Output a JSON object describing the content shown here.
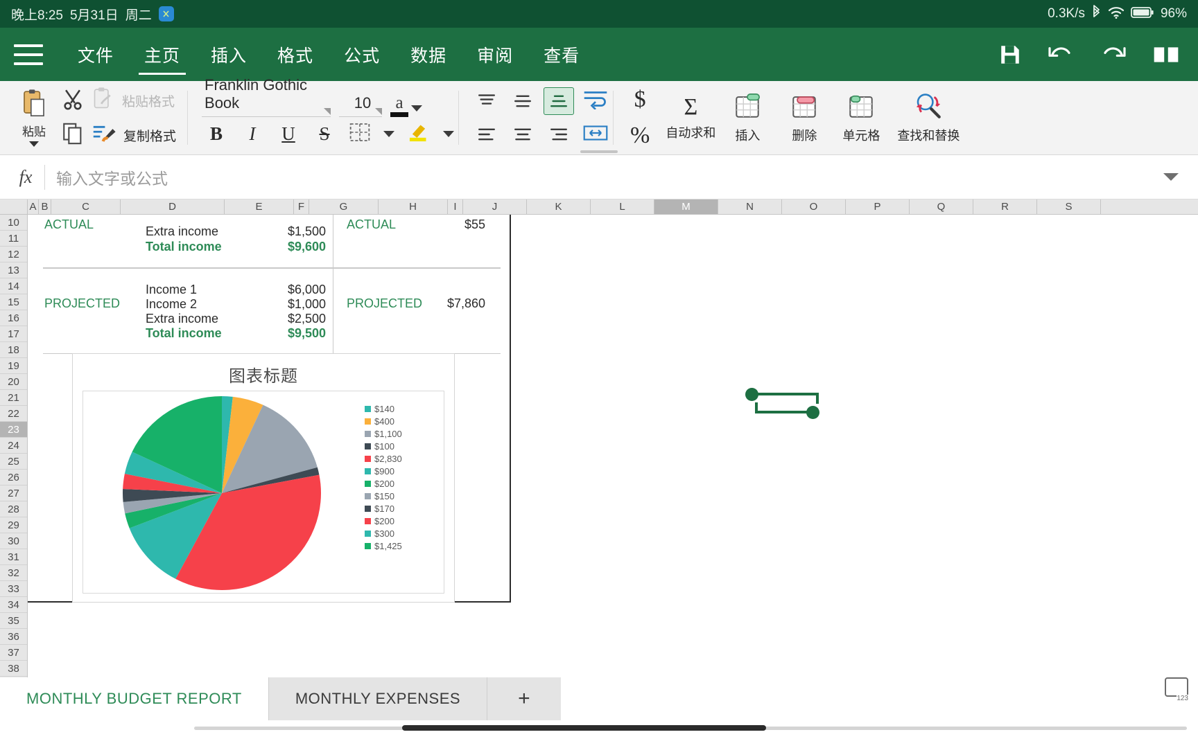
{
  "statusbar": {
    "time": "晚上8:25",
    "date": "5月31日",
    "weekday": "周二",
    "app_badge": "XL",
    "network_speed": "0.3K/s",
    "bluetooth_icon": "bluetooth-icon",
    "wifi_icon": "wifi-icon",
    "battery_icon": "battery-icon",
    "battery_text": "96%"
  },
  "ribbon": {
    "menu_icon": "hamburger-menu-icon",
    "tabs": [
      {
        "label": "文件",
        "active": false
      },
      {
        "label": "主页",
        "active": true
      },
      {
        "label": "插入",
        "active": false
      },
      {
        "label": "格式",
        "active": false
      },
      {
        "label": "公式",
        "active": false
      },
      {
        "label": "数据",
        "active": false
      },
      {
        "label": "审阅",
        "active": false
      },
      {
        "label": "查看",
        "active": false
      }
    ],
    "right_icons": [
      "save-icon",
      "undo-icon",
      "redo-icon",
      "read-mode-icon"
    ]
  },
  "toolbar": {
    "paste_label": "粘贴",
    "paste_icon": "paste-icon",
    "cut_icon": "cut-icon",
    "copy_icon": "copy-icon",
    "paste_format_label": "粘贴格式",
    "paste_format_icon": "paste-format-icon",
    "copy_format_label": "复制格式",
    "copy_format_icon": "format-painter-icon",
    "font_name": "Franklin Gothic Book",
    "font_size": "10",
    "font_color_glyph": "a",
    "font_color": "#111111",
    "bold": "B",
    "italic": "I",
    "underline": "U",
    "strikethrough": "S",
    "borders_icon": "borders-icon",
    "highlight_icon": "highlight-icon",
    "align_top_icon": "align-top-icon",
    "align_middle_icon": "align-middle-icon",
    "align_bottom_icon": "align-bottom-icon",
    "align_left_icon": "align-left-icon",
    "align_center_icon": "align-center-icon",
    "align_right_icon": "align-right-icon",
    "wrap_text_icon": "wrap-text-icon",
    "merge_cells_icon": "merge-cells-icon",
    "currency_icon": "$",
    "percent_icon": "%",
    "autosum_icon": "Σ",
    "autosum_label": "自动求和",
    "insert_label": "插入",
    "insert_icon": "insert-cells-icon",
    "delete_label": "删除",
    "delete_icon": "delete-cells-icon",
    "cell_label": "单元格",
    "cell_icon": "cell-format-icon",
    "find_replace_label": "查找和替换",
    "find_replace_icon": "find-replace-icon"
  },
  "formula_bar": {
    "fx_label": "fx",
    "placeholder": "输入文字或公式",
    "value": "",
    "expand_icon": "chevron-down-icon"
  },
  "grid": {
    "columns": [
      "A",
      "B",
      "C",
      "D",
      "E",
      "F",
      "G",
      "H",
      "I",
      "J",
      "K",
      "L",
      "M",
      "N",
      "O",
      "P",
      "Q",
      "R",
      "S"
    ],
    "selected_column": "M",
    "rows": [
      "10",
      "11",
      "12",
      "13",
      "14",
      "15",
      "16",
      "17",
      "18",
      "19",
      "20",
      "21",
      "22",
      "23",
      "24",
      "25",
      "26",
      "27",
      "28",
      "29",
      "30",
      "31",
      "32",
      "33",
      "34",
      "35",
      "36",
      "37",
      "38"
    ],
    "selected_row": "23",
    "cells": [
      {
        "row": 10,
        "col": "C",
        "text": "ACTUAL",
        "style": "green"
      },
      {
        "row": 10,
        "col": "D",
        "text": "Extra income",
        "style": "plain"
      },
      {
        "row": 10,
        "col": "E",
        "text": "$1,500",
        "style": "plain-right"
      },
      {
        "row": 10,
        "col": "G",
        "text": "ACTUAL",
        "style": "green"
      },
      {
        "row": 10,
        "col": "H",
        "text": "$55",
        "style": "plain-right"
      },
      {
        "row": 11,
        "col": "D",
        "text": "Total income",
        "style": "green-bold"
      },
      {
        "row": 11,
        "col": "E",
        "text": "$9,600",
        "style": "green-bold-right"
      },
      {
        "row": 14,
        "col": "D",
        "text": "Income 1",
        "style": "plain"
      },
      {
        "row": 14,
        "col": "E",
        "text": "$6,000",
        "style": "plain-right"
      },
      {
        "row": 15,
        "col": "C",
        "text": "PROJECTED",
        "style": "green"
      },
      {
        "row": 15,
        "col": "D",
        "text": "Income 2",
        "style": "plain"
      },
      {
        "row": 15,
        "col": "E",
        "text": "$1,000",
        "style": "plain-right"
      },
      {
        "row": 15,
        "col": "G",
        "text": "PROJECTED",
        "style": "green"
      },
      {
        "row": 15,
        "col": "H",
        "text": "$7,860",
        "style": "plain-right"
      },
      {
        "row": 16,
        "col": "D",
        "text": "Extra income",
        "style": "plain"
      },
      {
        "row": 16,
        "col": "E",
        "text": "$2,500",
        "style": "plain-right"
      },
      {
        "row": 17,
        "col": "D",
        "text": "Total income",
        "style": "green-bold"
      },
      {
        "row": 17,
        "col": "E",
        "text": "$9,500",
        "style": "green-bold-right"
      }
    ],
    "selection_handle_icon": "cell-selection-handles"
  },
  "chart_data": {
    "type": "pie",
    "title": "图表标题",
    "legend_position": "right",
    "labels": [
      "$140",
      "$400",
      "$1,100",
      "$100",
      "$2,830",
      "$900",
      "$200",
      "$150",
      "$170",
      "$200",
      "$300",
      "$1,425"
    ],
    "values": [
      140,
      400,
      1100,
      100,
      2830,
      900,
      200,
      150,
      170,
      200,
      300,
      1425
    ],
    "colors": [
      "#2eb8ad",
      "#fbb03b",
      "#9aa5b1",
      "#3e4a54",
      "#f6414a",
      "#2eb8ad",
      "#17b169",
      "#9aa5b1",
      "#3e4a54",
      "#f6414a",
      "#2eb8ad",
      "#17b169"
    ],
    "xlabel": "",
    "ylabel": ""
  },
  "sheet_tabs": {
    "tabs": [
      {
        "label": "MONTHLY BUDGET REPORT",
        "active": true
      },
      {
        "label": "MONTHLY EXPENSES",
        "active": false
      }
    ],
    "add_label": "+",
    "keyboard_icon": "keyboard-icon"
  }
}
